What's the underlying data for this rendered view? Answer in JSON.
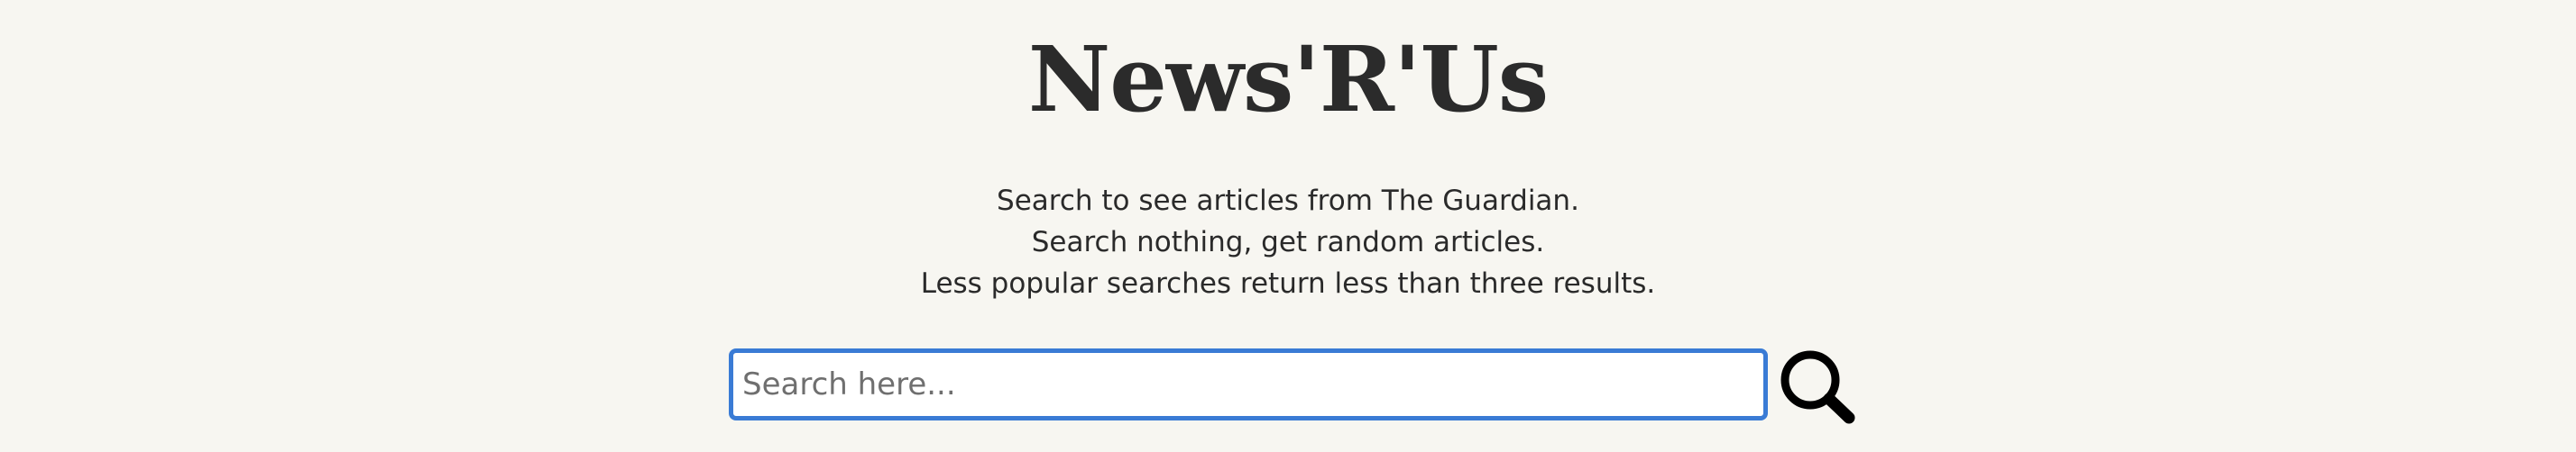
{
  "header": {
    "site_title": "News'R'Us"
  },
  "intro": {
    "lines": [
      "Search to see articles from The Guardian.",
      "Search nothing, get random articles.",
      "Less popular searches return less than three results."
    ]
  },
  "search": {
    "value": "",
    "placeholder": "Search here...",
    "button_icon": "search-icon",
    "accent_color": "#3a7bd5"
  }
}
